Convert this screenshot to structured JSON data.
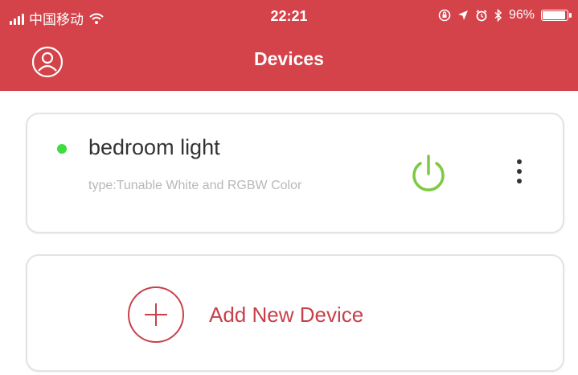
{
  "status_bar": {
    "carrier": "中国移动",
    "time": "22:21",
    "battery": "96%",
    "battery_level": 0.96,
    "icons": [
      "signal-icon",
      "wifi-icon",
      "screen-lock-icon",
      "location-icon",
      "alarm-icon",
      "bluetooth-icon",
      "battery-icon"
    ]
  },
  "header": {
    "title": "Devices",
    "profile_icon": "user-circle-icon",
    "background_color": "#d4424a"
  },
  "devices": [
    {
      "name": "bedroom light",
      "type": "type:Tunable White and RGBW Color",
      "status_color": "#3fdc3f",
      "power_icon": "power-icon",
      "power_color": "#7dc943",
      "menu_icon": "more-vertical-icon"
    }
  ],
  "add_device": {
    "label": "Add New Device",
    "icon": "plus-circle-icon",
    "color": "#c8404a"
  }
}
